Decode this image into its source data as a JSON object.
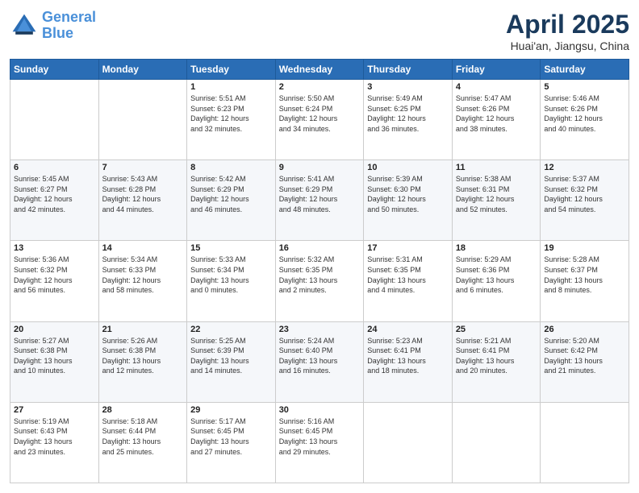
{
  "header": {
    "logo_line1": "General",
    "logo_line2": "Blue",
    "title": "April 2025",
    "subtitle": "Huai'an, Jiangsu, China"
  },
  "weekdays": [
    "Sunday",
    "Monday",
    "Tuesday",
    "Wednesday",
    "Thursday",
    "Friday",
    "Saturday"
  ],
  "weeks": [
    [
      {
        "day": "",
        "info": ""
      },
      {
        "day": "",
        "info": ""
      },
      {
        "day": "1",
        "info": "Sunrise: 5:51 AM\nSunset: 6:23 PM\nDaylight: 12 hours\nand 32 minutes."
      },
      {
        "day": "2",
        "info": "Sunrise: 5:50 AM\nSunset: 6:24 PM\nDaylight: 12 hours\nand 34 minutes."
      },
      {
        "day": "3",
        "info": "Sunrise: 5:49 AM\nSunset: 6:25 PM\nDaylight: 12 hours\nand 36 minutes."
      },
      {
        "day": "4",
        "info": "Sunrise: 5:47 AM\nSunset: 6:26 PM\nDaylight: 12 hours\nand 38 minutes."
      },
      {
        "day": "5",
        "info": "Sunrise: 5:46 AM\nSunset: 6:26 PM\nDaylight: 12 hours\nand 40 minutes."
      }
    ],
    [
      {
        "day": "6",
        "info": "Sunrise: 5:45 AM\nSunset: 6:27 PM\nDaylight: 12 hours\nand 42 minutes."
      },
      {
        "day": "7",
        "info": "Sunrise: 5:43 AM\nSunset: 6:28 PM\nDaylight: 12 hours\nand 44 minutes."
      },
      {
        "day": "8",
        "info": "Sunrise: 5:42 AM\nSunset: 6:29 PM\nDaylight: 12 hours\nand 46 minutes."
      },
      {
        "day": "9",
        "info": "Sunrise: 5:41 AM\nSunset: 6:29 PM\nDaylight: 12 hours\nand 48 minutes."
      },
      {
        "day": "10",
        "info": "Sunrise: 5:39 AM\nSunset: 6:30 PM\nDaylight: 12 hours\nand 50 minutes."
      },
      {
        "day": "11",
        "info": "Sunrise: 5:38 AM\nSunset: 6:31 PM\nDaylight: 12 hours\nand 52 minutes."
      },
      {
        "day": "12",
        "info": "Sunrise: 5:37 AM\nSunset: 6:32 PM\nDaylight: 12 hours\nand 54 minutes."
      }
    ],
    [
      {
        "day": "13",
        "info": "Sunrise: 5:36 AM\nSunset: 6:32 PM\nDaylight: 12 hours\nand 56 minutes."
      },
      {
        "day": "14",
        "info": "Sunrise: 5:34 AM\nSunset: 6:33 PM\nDaylight: 12 hours\nand 58 minutes."
      },
      {
        "day": "15",
        "info": "Sunrise: 5:33 AM\nSunset: 6:34 PM\nDaylight: 13 hours\nand 0 minutes."
      },
      {
        "day": "16",
        "info": "Sunrise: 5:32 AM\nSunset: 6:35 PM\nDaylight: 13 hours\nand 2 minutes."
      },
      {
        "day": "17",
        "info": "Sunrise: 5:31 AM\nSunset: 6:35 PM\nDaylight: 13 hours\nand 4 minutes."
      },
      {
        "day": "18",
        "info": "Sunrise: 5:29 AM\nSunset: 6:36 PM\nDaylight: 13 hours\nand 6 minutes."
      },
      {
        "day": "19",
        "info": "Sunrise: 5:28 AM\nSunset: 6:37 PM\nDaylight: 13 hours\nand 8 minutes."
      }
    ],
    [
      {
        "day": "20",
        "info": "Sunrise: 5:27 AM\nSunset: 6:38 PM\nDaylight: 13 hours\nand 10 minutes."
      },
      {
        "day": "21",
        "info": "Sunrise: 5:26 AM\nSunset: 6:38 PM\nDaylight: 13 hours\nand 12 minutes."
      },
      {
        "day": "22",
        "info": "Sunrise: 5:25 AM\nSunset: 6:39 PM\nDaylight: 13 hours\nand 14 minutes."
      },
      {
        "day": "23",
        "info": "Sunrise: 5:24 AM\nSunset: 6:40 PM\nDaylight: 13 hours\nand 16 minutes."
      },
      {
        "day": "24",
        "info": "Sunrise: 5:23 AM\nSunset: 6:41 PM\nDaylight: 13 hours\nand 18 minutes."
      },
      {
        "day": "25",
        "info": "Sunrise: 5:21 AM\nSunset: 6:41 PM\nDaylight: 13 hours\nand 20 minutes."
      },
      {
        "day": "26",
        "info": "Sunrise: 5:20 AM\nSunset: 6:42 PM\nDaylight: 13 hours\nand 21 minutes."
      }
    ],
    [
      {
        "day": "27",
        "info": "Sunrise: 5:19 AM\nSunset: 6:43 PM\nDaylight: 13 hours\nand 23 minutes."
      },
      {
        "day": "28",
        "info": "Sunrise: 5:18 AM\nSunset: 6:44 PM\nDaylight: 13 hours\nand 25 minutes."
      },
      {
        "day": "29",
        "info": "Sunrise: 5:17 AM\nSunset: 6:45 PM\nDaylight: 13 hours\nand 27 minutes."
      },
      {
        "day": "30",
        "info": "Sunrise: 5:16 AM\nSunset: 6:45 PM\nDaylight: 13 hours\nand 29 minutes."
      },
      {
        "day": "",
        "info": ""
      },
      {
        "day": "",
        "info": ""
      },
      {
        "day": "",
        "info": ""
      }
    ]
  ]
}
